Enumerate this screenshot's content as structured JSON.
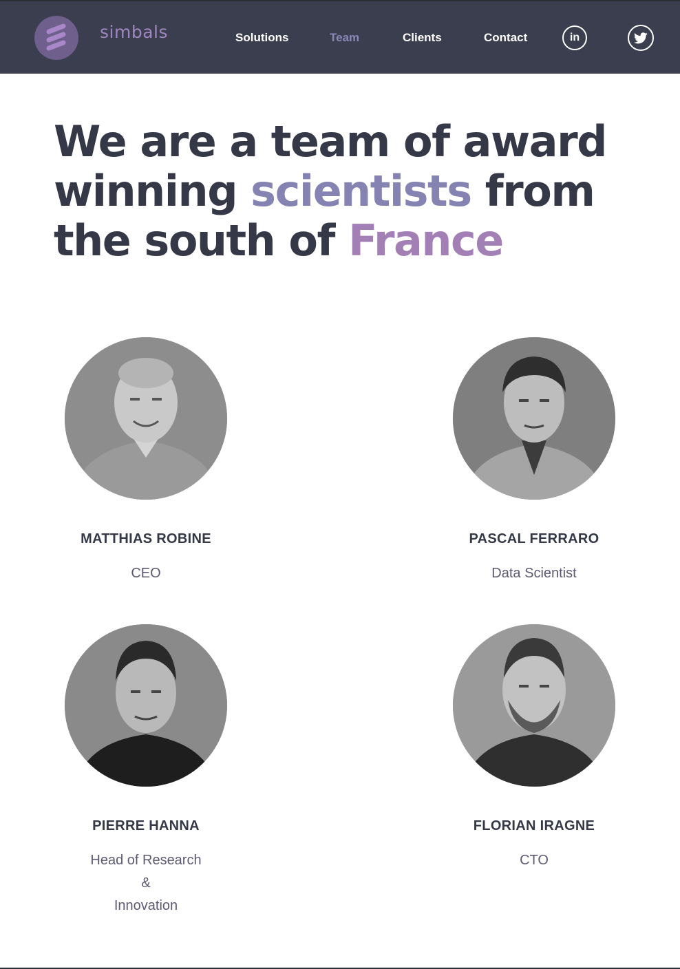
{
  "brand": {
    "name": "simbals"
  },
  "nav": {
    "items": [
      {
        "label": "Solutions",
        "active": false
      },
      {
        "label": "Team",
        "active": true
      },
      {
        "label": "Clients",
        "active": false
      },
      {
        "label": "Contact",
        "active": false
      }
    ],
    "social": {
      "linkedin_label": "in",
      "twitter_icon": "twitter-bird-icon"
    }
  },
  "headline": {
    "part1": "We are a team of award winning ",
    "highlight1": "scientists",
    "part2": " from the south of ",
    "highlight2": "France"
  },
  "team": [
    {
      "name": "MATTHIAS ROBINE",
      "role_lines": [
        "CEO"
      ]
    },
    {
      "name": "PASCAL FERRARO",
      "role_lines": [
        "Data Scientist"
      ]
    },
    {
      "name": "PIERRE HANNA",
      "role_lines": [
        "Head of Research",
        "&",
        "Innovation"
      ]
    },
    {
      "name": "FLORIAN IRAGNE",
      "role_lines": [
        "CTO"
      ]
    }
  ],
  "colors": {
    "header_bg": "#3b3e4f",
    "brand_purple": "#9f86c0",
    "accent_blue": "#8583b1",
    "accent_purple": "#a27fb5",
    "text_dark": "#353847"
  }
}
